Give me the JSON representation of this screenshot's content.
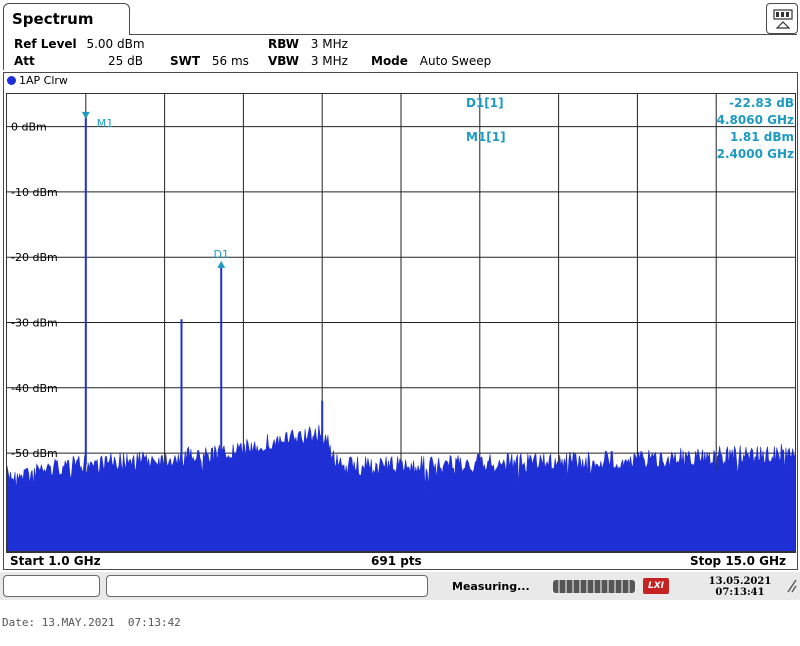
{
  "header": {
    "tab_title": "Spectrum",
    "ref_level_label": "Ref Level",
    "ref_level_value": "5.00 dBm",
    "att_label": "Att",
    "att_value": "25 dB",
    "swt_label": "SWT",
    "swt_value": "56 ms",
    "rbw_label": "RBW",
    "rbw_value": "3 MHz",
    "vbw_label": "VBW",
    "vbw_value": "3 MHz",
    "mode_label": "Mode",
    "mode_value": "Auto Sweep"
  },
  "trace": {
    "label": "1AP Clrw",
    "color": "#1f2fd6"
  },
  "markers": {
    "d1_label": "D1[1]",
    "d1_value": "-22.83 dB",
    "d1_freq": "4.8060 GHz",
    "m1_label": "M1[1]",
    "m1_value": "1.81 dBm",
    "m1_freq": "2.4000 GHz",
    "m1_tag": "M1",
    "d1_tag": "D1",
    "color": "#1d9ac4"
  },
  "footer": {
    "start": "Start 1.0 GHz",
    "points": "691 pts",
    "stop": "Stop 15.0 GHz"
  },
  "status": {
    "text": "Measuring...",
    "date": "13.05.2021",
    "time": "07:13:41",
    "lxi": "LXI"
  },
  "date_line": "Date: 13.MAY.2021  07:13:42",
  "chart_data": {
    "type": "line",
    "x_unit": "GHz",
    "y_unit": "dBm",
    "xlim": [
      1.0,
      15.0
    ],
    "ylim": [
      -65,
      5
    ],
    "y_ticks": [
      {
        "value": 0,
        "label": "0 dBm"
      },
      {
        "value": -10,
        "label": "-10 dBm"
      },
      {
        "value": -20,
        "label": "-20 dBm"
      },
      {
        "value": -30,
        "label": "-30 dBm"
      },
      {
        "value": -40,
        "label": "-40 dBm"
      },
      {
        "value": -50,
        "label": "-50 dBm"
      }
    ],
    "grid": true,
    "noise_profile": [
      {
        "x": 1.0,
        "y": -52
      },
      {
        "x": 2.0,
        "y": -50.5
      },
      {
        "x": 3.5,
        "y": -49.5
      },
      {
        "x": 5.0,
        "y": -48.5
      },
      {
        "x": 5.6,
        "y": -47
      },
      {
        "x": 6.6,
        "y": -45.5
      },
      {
        "x": 6.9,
        "y": -50.5
      },
      {
        "x": 8.0,
        "y": -50.5
      },
      {
        "x": 10.0,
        "y": -50
      },
      {
        "x": 12.0,
        "y": -49.5
      },
      {
        "x": 15.0,
        "y": -48.5
      }
    ],
    "peaks": [
      {
        "x": 2.4,
        "y": 1.81
      },
      {
        "x": 4.1,
        "y": -29.5
      },
      {
        "x": 4.806,
        "y": -21.02
      },
      {
        "x": 6.6,
        "y": -42
      }
    ],
    "marker_points": [
      {
        "name": "M1",
        "x": 2.4,
        "y": 1.81
      },
      {
        "name": "D1",
        "x": 4.806,
        "y": -21.02
      }
    ]
  }
}
